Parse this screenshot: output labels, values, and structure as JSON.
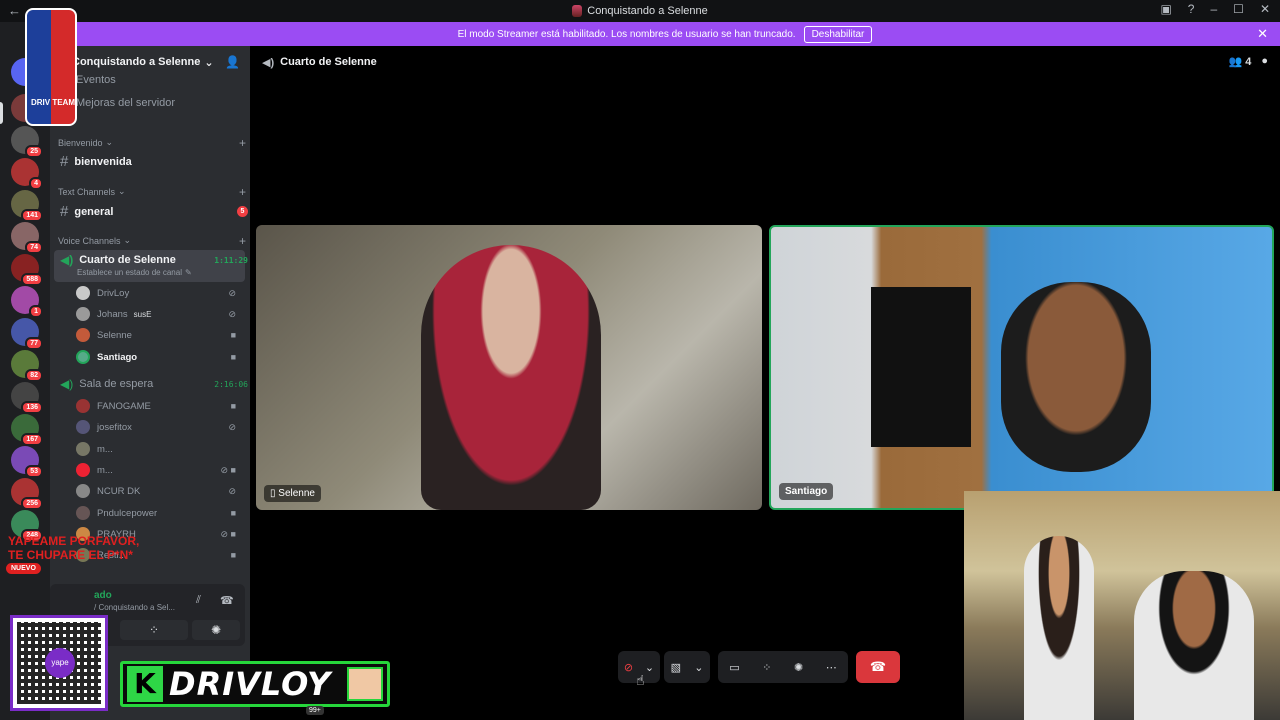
{
  "window": {
    "title": "Conquistando a Selenne"
  },
  "banner": {
    "message": "El modo Streamer está habilitado. Los nombres de usuario se han truncado.",
    "button": "Deshabilitar"
  },
  "rail": {
    "badges": [
      "25",
      "4",
      "141",
      "74",
      "588",
      "1",
      "77",
      "82",
      "136",
      "167",
      "53",
      "256",
      "248"
    ]
  },
  "server": {
    "name": "Conquistando a Selenne",
    "partial_items": [
      "Eventos",
      "Mejoras del servidor"
    ]
  },
  "categories": {
    "bienvenido": "Bienvenido",
    "text": "Text Channels",
    "voice": "Voice Channels"
  },
  "channels": {
    "bienvenida": "bienvenida",
    "general": "general",
    "general_unread": "5"
  },
  "voice": {
    "room1": {
      "name": "Cuarto de Selenne",
      "status": "Establece un estado de canal",
      "timer": "1:11:29",
      "users": [
        {
          "name": "DrivLoy"
        },
        {
          "name": "Johans",
          "extra": "susE"
        },
        {
          "name": "Selenne"
        },
        {
          "name": "Santiago"
        }
      ]
    },
    "room2": {
      "name": "Sala de espera",
      "timer": "2:16:06",
      "users": [
        {
          "name": "FANOGAME"
        },
        {
          "name": "josefitox"
        },
        {
          "name": "m..."
        },
        {
          "name": "m..."
        },
        {
          "name": "NCUR DK"
        },
        {
          "name": "Pndulcepower"
        },
        {
          "name": "PRAYRH"
        },
        {
          "name": "Resti..."
        }
      ]
    }
  },
  "userpanel": {
    "status": "ado",
    "sub": "/ Conquistando a Sel..."
  },
  "stage": {
    "channel": "Cuarto de Selenne",
    "members": "4",
    "tiles": [
      {
        "name": "Selenne"
      },
      {
        "name": "Santiago"
      }
    ]
  },
  "overlay": {
    "logo": "DRIV TEAM",
    "red_text_1": "YAPEAME PORFAVOR,",
    "red_text_2": "TE CHUPARE EL P*N*",
    "nuevo": "NUEVO",
    "qr_label": "yape",
    "brand": "DRIVLOY",
    "brand_k": "K"
  },
  "taskbar": {
    "badge": "99+"
  }
}
